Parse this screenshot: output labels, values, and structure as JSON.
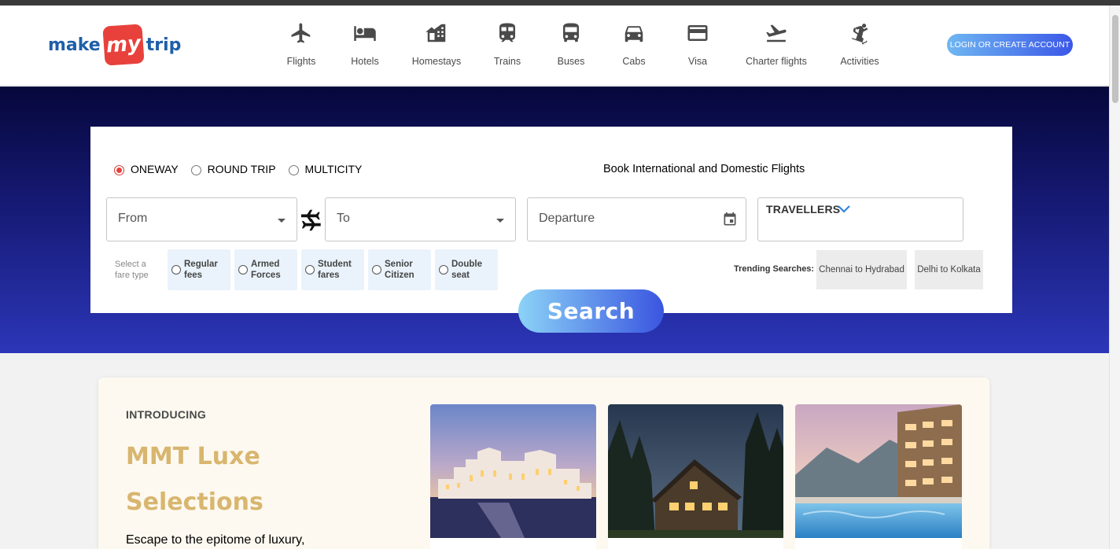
{
  "header": {
    "logo": {
      "left": "make",
      "mid": "my",
      "right": "trip"
    },
    "nav": [
      {
        "label": "Flights",
        "icon": "flight-icon"
      },
      {
        "label": "Hotels",
        "icon": "hotel-bed-icon"
      },
      {
        "label": "Homestays",
        "icon": "homestay-icon"
      },
      {
        "label": "Trains",
        "icon": "train-icon"
      },
      {
        "label": "Buses",
        "icon": "bus-icon"
      },
      {
        "label": "Cabs",
        "icon": "cab-icon"
      },
      {
        "label": "Visa",
        "icon": "card-icon"
      },
      {
        "label": "Charter flights",
        "icon": "flight-takeoff-icon"
      },
      {
        "label": "Activities",
        "icon": "skiing-icon"
      }
    ],
    "login_label": "LOGIN OR CREATE ACCOUNT"
  },
  "search": {
    "trip_types": [
      {
        "label": "ONEWAY",
        "selected": true
      },
      {
        "label": "ROUND TRIP",
        "selected": false
      },
      {
        "label": "MULTICITY",
        "selected": false
      }
    ],
    "heading": "Book International and Domestic Flights",
    "from_placeholder": "From",
    "to_placeholder": "To",
    "departure_placeholder": "Departure",
    "travellers_label": "TRAVELLERS",
    "fare_type_label": "Select a fare type",
    "fare_types": [
      {
        "line1": "Regular",
        "line2": "fees"
      },
      {
        "line1": "Armed",
        "line2": "Forces"
      },
      {
        "line1": "Student",
        "line2": "fares"
      },
      {
        "line1": "Senior",
        "line2": "Citizen"
      },
      {
        "line1": "Double",
        "line2": "seat"
      }
    ],
    "trending_label": "Trending Searches:",
    "trending": [
      "Chennai to Hydrabad",
      "Delhi to Kolkata"
    ],
    "search_label": "Search"
  },
  "luxe": {
    "intro": "INTRODUCING",
    "title_line1": "MMT Luxe",
    "title_line2": "Selections",
    "description": "Escape to the epitome of luxury,"
  },
  "colors": {
    "brand_blue": "#1f5fa8",
    "brand_red": "#e8413c",
    "hero_top": "#06073b",
    "hero_bottom": "#2c36b8",
    "luxe_gold": "#d8b66f"
  }
}
